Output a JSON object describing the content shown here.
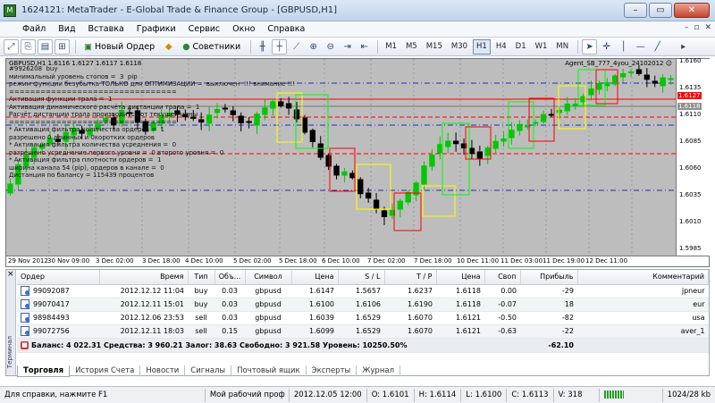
{
  "window": {
    "title": "1624121: MetaTrader - E-Global Trade & Finance Group - [GBPUSD,H1]",
    "controls": [
      "–",
      "▭",
      "✕"
    ]
  },
  "menu": [
    "Файл",
    "Вид",
    "Вставка",
    "Графики",
    "Сервис",
    "Окно",
    "Справка"
  ],
  "toolbar": {
    "new_order": "Новый Ордер",
    "experts": "Советники",
    "timeframes": [
      "M1",
      "M5",
      "M15",
      "M30",
      "H1",
      "H4",
      "D1",
      "W1",
      "MN"
    ],
    "active_timeframe": "H1"
  },
  "chart": {
    "header": "GBPUSD,H1  1.6116 1.6127 1.6117 1.6118",
    "expert_label": "Agent_SB_777_4you_24102012 ☺",
    "overlay_lines": [
      "#9926208  buy",
      "минимальный уровень стопов =  3  pip",
      "режим функции безубытка ТОЛЬКО для ОПТИМИЗАЦИИ =  выключен  !!! внимание !!!",
      "================================",
      "Активация функции трала =  1",
      "Активация динамического расчёта дистанции трала =  1",
      "Расчёт дистанции трала производится от текущей цены",
      "================================",
      "* Активация фильтра количества ордеров =  1",
      "разрешено 0 длинных и 0коротких ордеров",
      "* Активация фильтра количества усреднения =  0",
      "разрешено усреднение первого уровня =  0 второго уровня =  0",
      "* Активация фильтра плотности ордеров =  1",
      "ширина канала 54 (pip), ордеров в канале =  0",
      "Дистанция по баланcу = 115439 процентов"
    ],
    "price_ticks": [
      "1.6160",
      "1.6135",
      "1.6110",
      "1.6085",
      "1.6060",
      "1.6035",
      "1.6010",
      "1.5985"
    ],
    "price_markers": [
      {
        "label": "1.6127",
        "style": "red"
      },
      {
        "label": "1.6118",
        "style": "gray"
      }
    ],
    "time_ticks": [
      "29 Nov 2012",
      "30 Nov 09:00",
      "3 Dec 02:00",
      "3 Dec 18:00",
      "4 Dec 10:00",
      "5 Dec 02:00",
      "5 Dec 18:00",
      "6 Dec 10:00",
      "7 Dec 02:00",
      "7 Dec 18:00",
      "10 Dec 11:00",
      "11 Dec 03:00",
      "11 Dec 19:00",
      "12 Dec 11:00"
    ],
    "colors": {
      "background": "#bdbdbd",
      "bull": "#00c800",
      "bear": "#000000",
      "stop_line": "#ff0000",
      "grid": "#9a9a9a"
    }
  },
  "terminal": {
    "side_label": "Терминал",
    "columns": [
      "Ордер",
      "Время",
      "Тип",
      "Объ...",
      "Символ",
      "Цена",
      "S / L",
      "T / P",
      "Цена",
      "Своп",
      "Прибыль",
      "Комментарий"
    ],
    "orders": [
      [
        "99092087",
        "2012.12.12 11:04",
        "buy",
        "0.03",
        "gbpusd",
        "1.6147",
        "1.5657",
        "1.6237",
        "1.6118",
        "0.00",
        "-29",
        "jpneur"
      ],
      [
        "99070417",
        "2012.12.11 15:01",
        "buy",
        "0.03",
        "gbpusd",
        "1.6100",
        "1.6106",
        "1.6190",
        "1.6118",
        "-0.07",
        "18",
        "eur"
      ],
      [
        "98984493",
        "2012.12.06 23:53",
        "sell",
        "0.03",
        "gbpusd",
        "1.6039",
        "1.6529",
        "1.6070",
        "1.6121",
        "-0.50",
        "-82",
        "usa"
      ],
      [
        "99072756",
        "2012.12.11 18:03",
        "sell",
        "0.15",
        "gbpusd",
        "1.6099",
        "1.6529",
        "1.6070",
        "1.6121",
        "-0.63",
        "-22",
        "aver_1"
      ]
    ],
    "summary": "Баланс: 4 022.31  Средства: 3 960.21  Залог: 38.63  Свободно: 3 921.58  Уровень: 10250.50%",
    "summary_profit": "-62.10",
    "tabs": [
      "Торговля",
      "История Счета",
      "Новости",
      "Сигналы",
      "Почтовый ящик",
      "Эксперты",
      "Журнал"
    ],
    "active_tab": "Торговля"
  },
  "status": {
    "help": "Для справки, нажмите F1",
    "profile": "Мой рабочий проф",
    "datetime": "2012.12.05 12:00",
    "open": "O: 1.6101",
    "high": "H: 1.6114",
    "low": "L: 1.6100",
    "close": "C: 1.6113",
    "volume": "V: 318",
    "traffic": "1024/28 kb"
  }
}
